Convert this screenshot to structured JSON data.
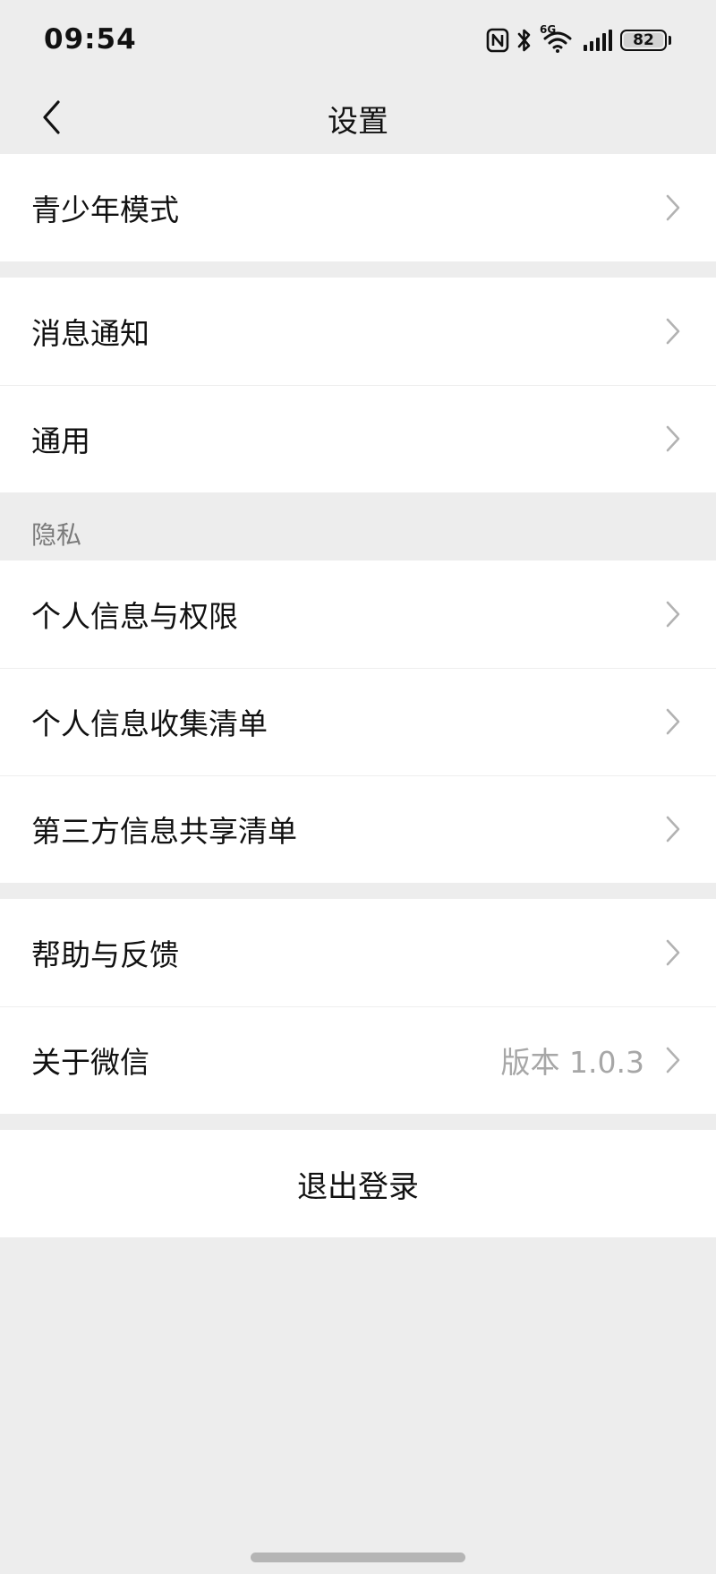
{
  "status_bar": {
    "time": "09:54",
    "battery_level": "82",
    "network_label": "6G",
    "icons": [
      "nfc-icon",
      "bluetooth-icon",
      "wifi-icon",
      "signal-icon",
      "battery-icon"
    ]
  },
  "header": {
    "title": "设置",
    "back_icon": "chevron-left-icon"
  },
  "groups": {
    "youth": {
      "teen_mode": "青少年模式"
    },
    "general": {
      "notifications": "消息通知",
      "general": "通用"
    },
    "privacy": {
      "section_title": "隐私",
      "permissions": "个人信息与权限",
      "info_collection": "个人信息收集清单",
      "third_party": "第三方信息共享清单"
    },
    "about": {
      "help": "帮助与反馈",
      "about_wechat": "关于微信",
      "version": "版本 1.0.3"
    }
  },
  "logout_label": "退出登录",
  "colors": {
    "background": "#ededed",
    "card": "#ffffff",
    "text_primary": "#111111",
    "text_secondary": "#a7a7a7",
    "chevron": "#b2b2b2"
  }
}
